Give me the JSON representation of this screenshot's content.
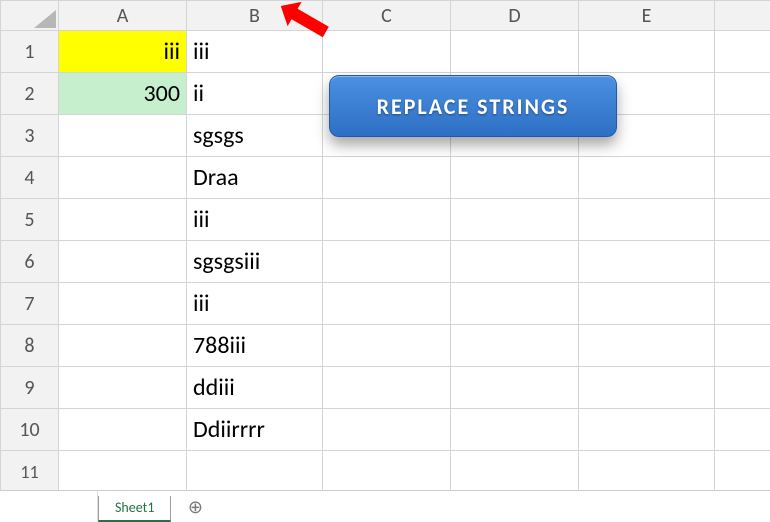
{
  "columns": {
    "A": "A",
    "B": "B",
    "C": "C",
    "D": "D",
    "E": "E"
  },
  "rows": {
    "r1": "1",
    "r2": "2",
    "r3": "3",
    "r4": "4",
    "r5": "5",
    "r6": "6",
    "r7": "7",
    "r8": "8",
    "r9": "9",
    "r10": "10",
    "r11": "11"
  },
  "cells": {
    "A1": "iii",
    "B1": "iii",
    "A2": "300",
    "B2": "ii",
    "B3": "sgsgs",
    "B4": "Draa",
    "B5": "iii",
    "B6": "sgsgsiii",
    "B7": "iii",
    "B8": "788iii",
    "B9": "ddiii",
    "B10": "Ddiirrrr"
  },
  "button": {
    "label": "REPLACE  STRINGS"
  },
  "tabs": {
    "sheet1": "Sheet1"
  },
  "icons": {
    "add": "⊕"
  },
  "chart_data": {
    "type": "table",
    "columns": [
      "A",
      "B"
    ],
    "rows": [
      {
        "row": 1,
        "A": "iii",
        "B": "iii"
      },
      {
        "row": 2,
        "A": 300,
        "B": "ii"
      },
      {
        "row": 3,
        "A": "",
        "B": "sgsgs"
      },
      {
        "row": 4,
        "A": "",
        "B": "Draa"
      },
      {
        "row": 5,
        "A": "",
        "B": "iii"
      },
      {
        "row": 6,
        "A": "",
        "B": "sgsgsiii"
      },
      {
        "row": 7,
        "A": "",
        "B": "iii"
      },
      {
        "row": 8,
        "A": "",
        "B": "788iii"
      },
      {
        "row": 9,
        "A": "",
        "B": "ddiii"
      },
      {
        "row": 10,
        "A": "",
        "B": "Ddiirrrr"
      }
    ],
    "highlights": {
      "A1": "yellow",
      "A2": "green"
    },
    "annotation": {
      "arrow_pointing_to_column": "B"
    },
    "button_label": "REPLACE  STRINGS"
  }
}
